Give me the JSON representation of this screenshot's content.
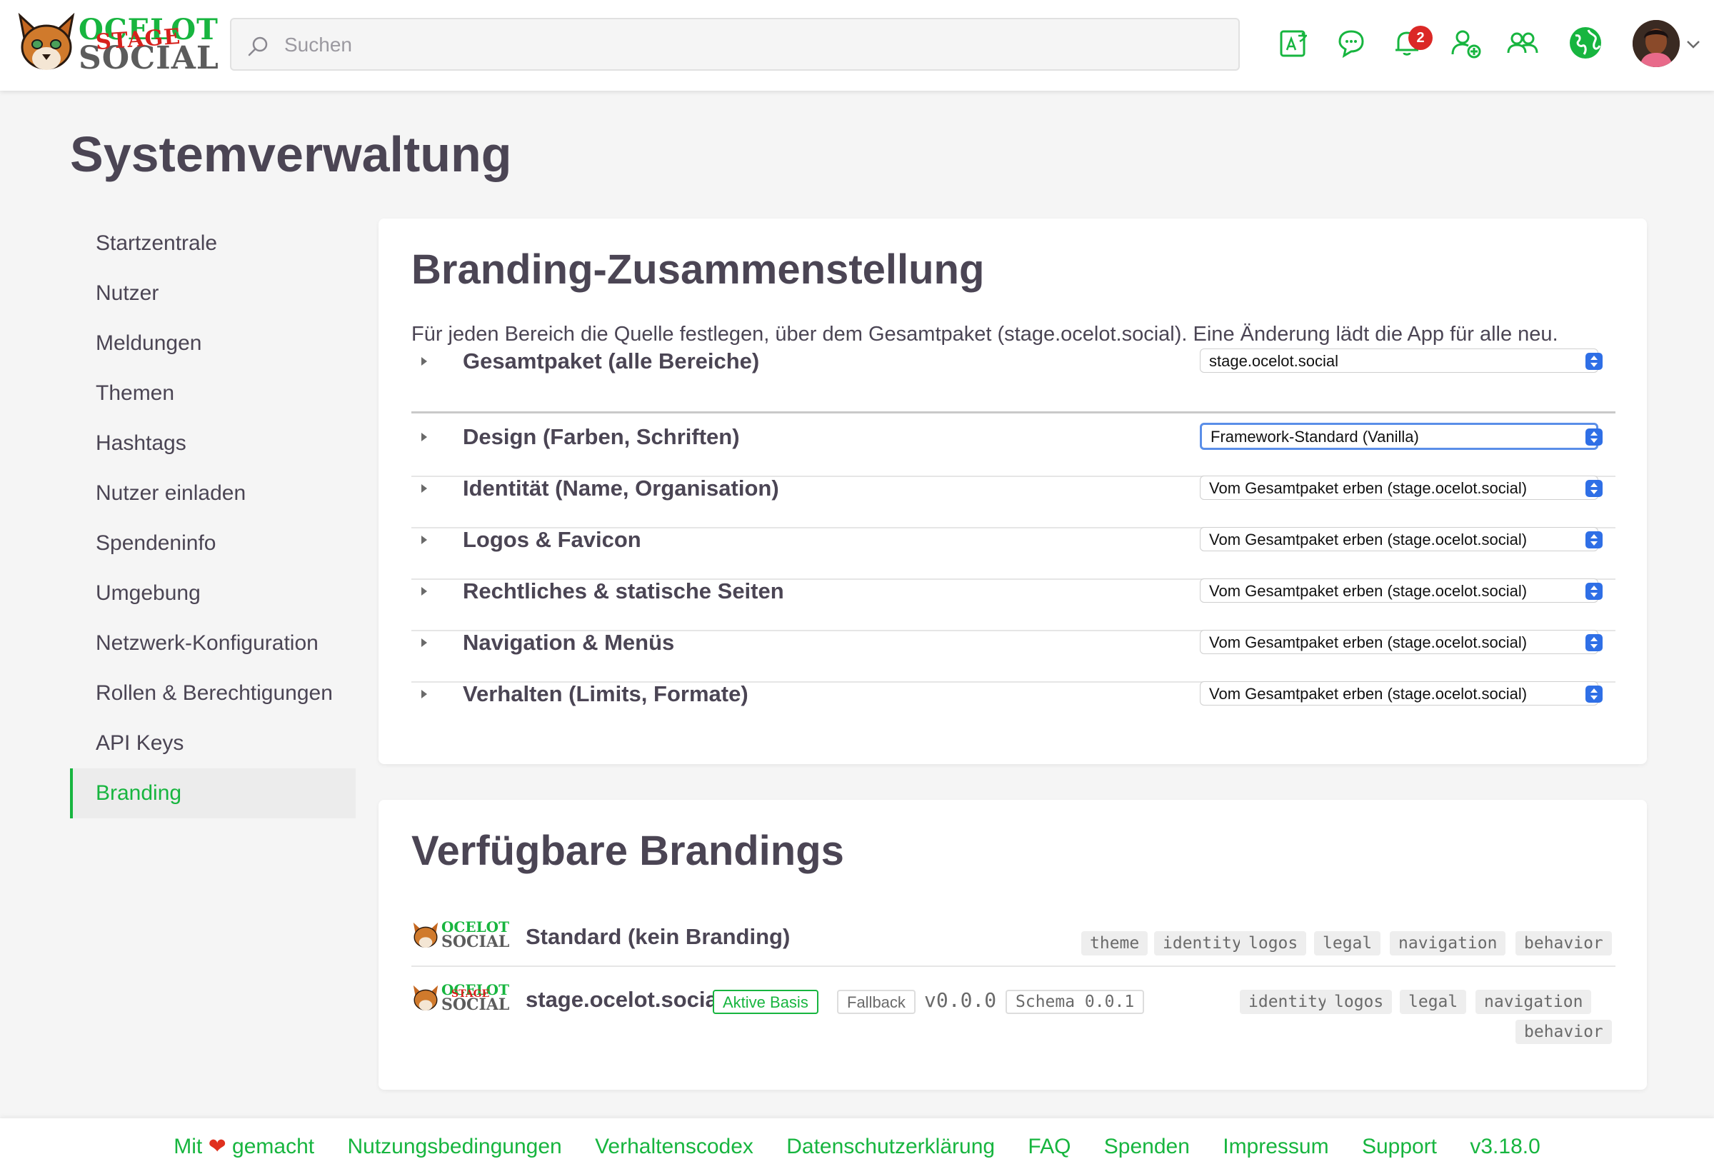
{
  "app": {
    "logo_top": "OCELOT",
    "logo_stage": "STAGE",
    "logo_bottom": "SOCIAL"
  },
  "header": {
    "search_placeholder": "Suchen",
    "notification_count": "2",
    "icons": [
      "translate-icon",
      "chat-icon",
      "bell-icon",
      "user-plus-icon",
      "users-icon",
      "globe-icon",
      "avatar",
      "chevron-down-icon"
    ]
  },
  "page": {
    "title": "Systemverwaltung"
  },
  "sidebar": {
    "items": [
      {
        "label": "Startzentrale"
      },
      {
        "label": "Nutzer"
      },
      {
        "label": "Meldungen"
      },
      {
        "label": "Themen"
      },
      {
        "label": "Hashtags"
      },
      {
        "label": "Nutzer einladen"
      },
      {
        "label": "Spendeninfo"
      },
      {
        "label": "Umgebung"
      },
      {
        "label": "Netzwerk-Konfiguration"
      },
      {
        "label": "Rollen & Berechtigungen"
      },
      {
        "label": "API Keys"
      },
      {
        "label": "Branding"
      }
    ],
    "active": "Branding"
  },
  "composition": {
    "title": "Branding-Zusammenstellung",
    "description": "Für jeden Bereich die Quelle festlegen, über dem Gesamtpaket (stage.ocelot.social). Eine Änderung lädt die App für alle neu.",
    "rows": [
      {
        "label": "Gesamtpaket (alle Bereiche)",
        "value": "stage.ocelot.social"
      },
      {
        "label": "Design (Farben, Schriften)",
        "value": "Framework-Standard (Vanilla)"
      },
      {
        "label": "Identität (Name, Organisation)",
        "value": "Vom Gesamtpaket erben (stage.ocelot.social)"
      },
      {
        "label": "Logos & Favicon",
        "value": "Vom Gesamtpaket erben (stage.ocelot.social)"
      },
      {
        "label": "Rechtliches & statische Seiten",
        "value": "Vom Gesamtpaket erben (stage.ocelot.social)"
      },
      {
        "label": "Navigation & Menüs",
        "value": "Vom Gesamtpaket erben (stage.ocelot.social)"
      },
      {
        "label": "Verhalten (Limits, Formate)",
        "value": "Vom Gesamtpaket erben (stage.ocelot.social)"
      }
    ]
  },
  "available": {
    "title": "Verfügbare Brandings",
    "items": [
      {
        "name": "Standard (kein Branding)",
        "logo_top": "OCELOT",
        "logo_bottom": "SOCIAL",
        "tags": [
          "theme",
          "identity",
          "logos",
          "legal",
          "navigation",
          "behavior"
        ]
      },
      {
        "name": "stage.ocelot.social",
        "logo_top": "OCELOT",
        "logo_stage": "STAGE",
        "logo_bottom": "SOCIAL",
        "badge_active": "Aktive Basis",
        "badge_fallback": "Fallback",
        "version": "v0.0.0",
        "schema": "Schema 0.0.1",
        "tags": [
          "identity",
          "logos",
          "legal",
          "navigation",
          "behavior"
        ]
      }
    ]
  },
  "footer": {
    "made_with_prefix": "Mit",
    "made_with_suffix": "gemacht",
    "links": [
      "Nutzungsbedingungen",
      "Verhaltenscodex",
      "Datenschutzerklärung",
      "FAQ",
      "Spenden",
      "Impressum",
      "Support"
    ],
    "version": "v3.18.0"
  },
  "colors": {
    "accent": "#17b53f",
    "badge": "#db2826",
    "text": "#4b4554",
    "background": "#f5f5f5"
  }
}
